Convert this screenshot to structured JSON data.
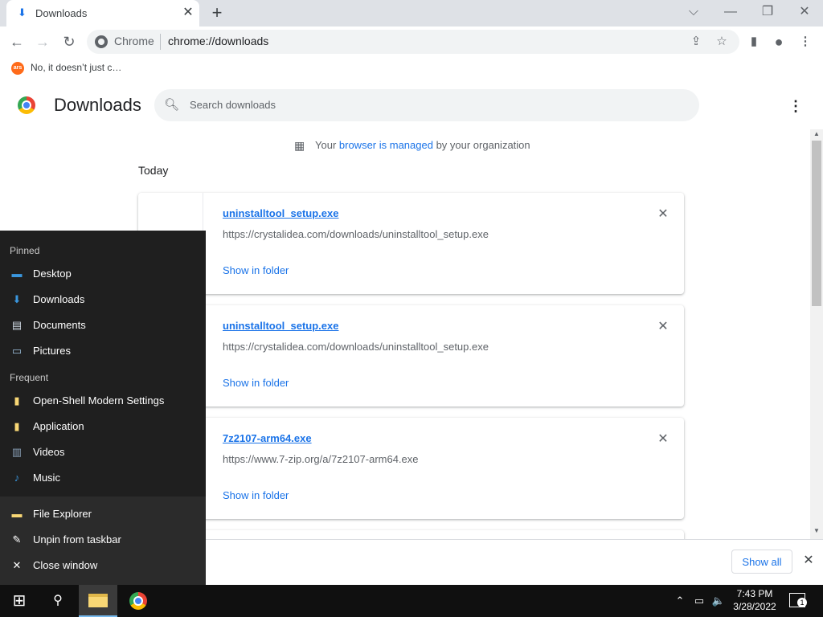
{
  "browser": {
    "tab": {
      "title": "Downloads",
      "icon": "download-icon"
    },
    "new_tab_label": "+",
    "window_controls": {
      "menu": "⌵",
      "minimize": "—",
      "restore": "❐",
      "close": "✕"
    },
    "nav": {
      "back": "←",
      "forward": "→",
      "reload": "↻"
    },
    "omnibox": {
      "site_label": "Chrome",
      "url": "chrome://downloads"
    },
    "toolbar_icons": {
      "share": "⇪",
      "bookmark": "☆",
      "side_panel": "▮",
      "profile": "●",
      "menu": "⋮"
    },
    "bookmark": {
      "label": "No, it doesn’t just c…",
      "icon_text": "ars"
    }
  },
  "page": {
    "title": "Downloads",
    "search_placeholder": "Search downloads",
    "menu_glyph": "⋮",
    "managed": {
      "prefix": "Your ",
      "link": "browser is managed",
      "suffix": " by your organization"
    },
    "date_header": "Today",
    "downloads": [
      {
        "name": "uninstalltool_setup.exe",
        "url": "https://crystalidea.com/downloads/uninstalltool_setup.exe",
        "action": "Show in folder"
      },
      {
        "name": "uninstalltool_setup.exe",
        "url": "https://crystalidea.com/downloads/uninstalltool_setup.exe",
        "action": "Show in folder"
      },
      {
        "name": "7z2107-arm64.exe",
        "url": "https://www.7-zip.org/a/7z2107-arm64.exe",
        "action": "Show in folder"
      }
    ],
    "close_glyph": "✕"
  },
  "shelf": {
    "show_all": "Show all",
    "close": "✕"
  },
  "jumplist": {
    "pinned_header": "Pinned",
    "pinned": [
      {
        "label": "Desktop",
        "icon": "desktop-icon",
        "glyph": "▬",
        "color": "#3a96dd"
      },
      {
        "label": "Downloads",
        "icon": "download-icon",
        "glyph": "⬇",
        "color": "#3a96dd"
      },
      {
        "label": "Documents",
        "icon": "documents-icon",
        "glyph": "▤",
        "color": "#cfd8e3"
      },
      {
        "label": "Pictures",
        "icon": "pictures-icon",
        "glyph": "▭",
        "color": "#9fc3e0"
      }
    ],
    "frequent_header": "Frequent",
    "frequent": [
      {
        "label": "Open-Shell Modern Settings",
        "icon": "folder-icon",
        "glyph": "▮",
        "color": "#f8d775"
      },
      {
        "label": "Application",
        "icon": "folder-icon",
        "glyph": "▮",
        "color": "#f8d775"
      },
      {
        "label": "Videos",
        "icon": "videos-icon",
        "glyph": "▥",
        "color": "#8aa0b8"
      },
      {
        "label": "Music",
        "icon": "music-icon",
        "glyph": "♪",
        "color": "#3a96dd"
      }
    ],
    "tasks": [
      {
        "label": "File Explorer",
        "icon": "file-explorer-icon",
        "glyph": "▬",
        "color": "#f8d775"
      },
      {
        "label": "Unpin from taskbar",
        "icon": "unpin-icon",
        "glyph": "✎",
        "color": "#ffffff"
      },
      {
        "label": "Close window",
        "icon": "close-icon",
        "glyph": "✕",
        "color": "#ffffff"
      }
    ]
  },
  "taskbar": {
    "start_glyph": "⊞",
    "search_glyph": "⚲",
    "tray": {
      "chevron": "⌃",
      "network": "▭",
      "volume": "🔈"
    },
    "time": "7:43 PM",
    "date": "3/28/2022",
    "notification_count": "1"
  }
}
